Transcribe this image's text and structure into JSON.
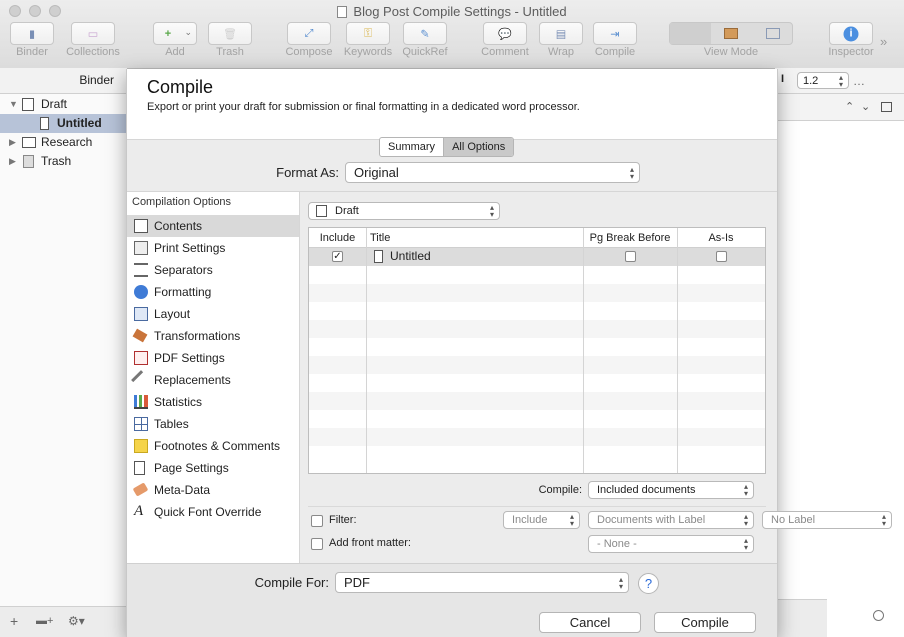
{
  "window": {
    "title": "Blog Post Compile Settings - Untitled"
  },
  "toolbar": {
    "items": [
      {
        "label": "Binder",
        "glyph": "▮"
      },
      {
        "label": "Collections",
        "glyph": "▭"
      },
      {
        "label": "Add",
        "glyph": "+"
      },
      {
        "label": "Trash",
        "glyph": "🗑"
      },
      {
        "label": "Compose",
        "glyph": "⤢"
      },
      {
        "label": "Keywords",
        "glyph": "⚿"
      },
      {
        "label": "QuickRef",
        "glyph": "✎"
      },
      {
        "label": "Comment",
        "glyph": "💬"
      },
      {
        "label": "Wrap",
        "glyph": "▤"
      },
      {
        "label": "Compile",
        "glyph": "⇥"
      },
      {
        "label": "View Mode",
        "glyph": "▥"
      },
      {
        "label": "Inspector",
        "glyph": "i"
      }
    ],
    "more": "»"
  },
  "binder": {
    "header": "Binder",
    "items": [
      {
        "label": "Draft"
      },
      {
        "label": "Untitled"
      },
      {
        "label": "Research"
      },
      {
        "label": "Trash"
      }
    ]
  },
  "editor": {
    "line_spacing": "1.2"
  },
  "dialog": {
    "title": "Compile",
    "subtitle": "Export or print your draft for submission or final formatting in a dedicated word processor.",
    "tabs": [
      "Summary",
      "All Options"
    ],
    "format_as": {
      "label": "Format As:",
      "value": "Original"
    },
    "options_header": "Compilation Options",
    "options": [
      "Contents",
      "Print Settings",
      "Separators",
      "Formatting",
      "Layout",
      "Transformations",
      "PDF Settings",
      "Replacements",
      "Statistics",
      "Tables",
      "Footnotes & Comments",
      "Page Settings",
      "Meta-Data",
      "Quick Font Override"
    ],
    "folder": {
      "value": "Draft"
    },
    "table": {
      "columns": [
        "Include",
        "Title",
        "Pg Break Before",
        "As-Is"
      ],
      "rows": [
        {
          "include": true,
          "title": "Untitled",
          "pg_break": false,
          "as_is": false
        }
      ]
    },
    "compile_row": {
      "label": "Compile:",
      "value": "Included documents"
    },
    "filter": {
      "label": "Filter:",
      "mode": "Include",
      "by": "Documents with Label",
      "label_value": "No Label"
    },
    "front_matter": {
      "label": "Add front matter:",
      "value": "- None -"
    },
    "compile_for": {
      "label": "Compile For:",
      "value": "PDF"
    },
    "help": "?",
    "cancel_label": "Cancel",
    "compile_label": "Compile"
  }
}
